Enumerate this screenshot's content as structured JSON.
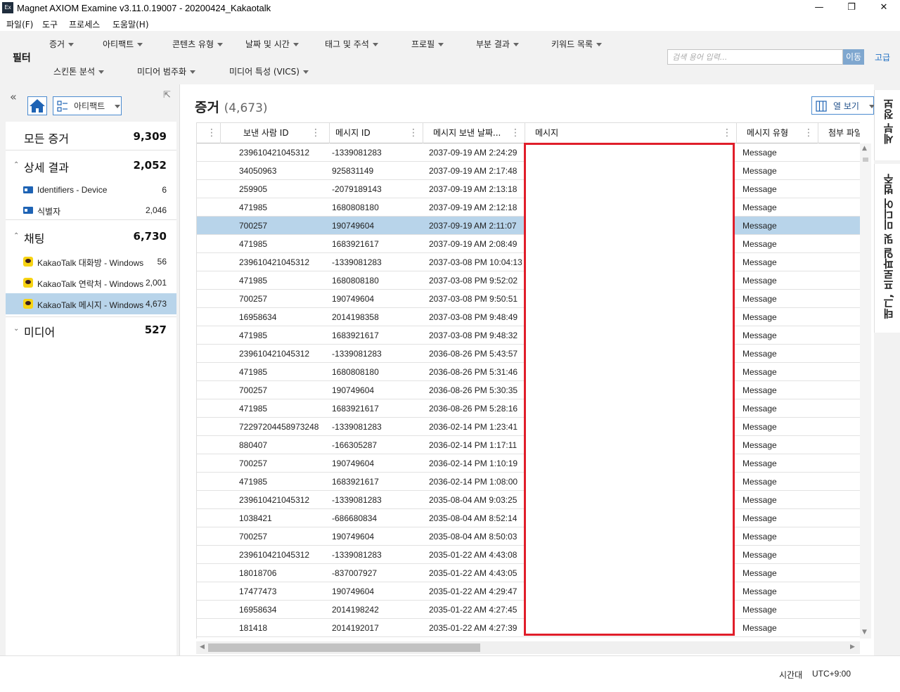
{
  "window": {
    "icon_text": "Ex",
    "title": "Magnet AXIOM Examine v3.11.0.19007 - 20200424_Kakaotalk",
    "minimize": "—",
    "restore": "❐",
    "close": "✕"
  },
  "menu": [
    "파일(F)",
    "도구",
    "프로세스",
    "도움말(H)"
  ],
  "filter": {
    "label": "필터",
    "row1": [
      "증거",
      "아티팩트",
      "콘텐츠 유형",
      "날짜 및 시간",
      "태그 및 주석",
      "프로필",
      "부분 결과",
      "키워드 목록"
    ],
    "row2": [
      "스킨톤 분석",
      "미디어 범주화",
      "미디어 특성 (VICS)"
    ],
    "search_placeholder": "검색 용어 입력...",
    "go_label": "이동",
    "advanced_label": "고급"
  },
  "left": {
    "collapse_glyph": "«",
    "pin_glyph": "⇱",
    "artifact_dropdown": "아티팩트",
    "all_evidence": {
      "label": "모든 증거",
      "count": "9,309"
    },
    "categories": [
      {
        "label": "상세 결과",
        "count": "2,052",
        "expanded": true,
        "items": [
          {
            "label": "Identifiers - Device",
            "count": "6",
            "icon": "id-card-icon"
          },
          {
            "label": "식별자",
            "count": "2,046",
            "icon": "id-card-icon"
          }
        ]
      },
      {
        "label": "채팅",
        "count": "6,730",
        "expanded": true,
        "items": [
          {
            "label": "KakaoTalk 대화방 - Windows",
            "count": "56",
            "icon": "kakaotalk-icon"
          },
          {
            "label": "KakaoTalk 연락처 - Windows",
            "count": "2,001",
            "icon": "kakaotalk-icon"
          },
          {
            "label": "KakaoTalk 메시지 - Windows",
            "count": "4,673",
            "icon": "kakaotalk-icon",
            "selected": true
          }
        ]
      },
      {
        "label": "미디어",
        "count": "527",
        "expanded": false,
        "items": []
      }
    ]
  },
  "main": {
    "title": "증거",
    "count": "(4,673)",
    "view_button": "열 보기",
    "columns": [
      "보낸 사람 ID",
      "메시지 ID",
      "메시지 보낸 날짜...",
      "메시지",
      "메시지 유형",
      "첨부 파일"
    ],
    "rows": [
      [
        "239610421045312",
        "-1339081283",
        "2037-09-19 AM 2:24:29",
        "",
        "Message"
      ],
      [
        "34050963",
        "925831149",
        "2037-09-19 AM 2:17:48",
        "",
        "Message"
      ],
      [
        "259905",
        "-2079189143",
        "2037-09-19 AM 2:13:18",
        "",
        "Message"
      ],
      [
        "471985",
        "1680808180",
        "2037-09-19 AM 2:12:18",
        "",
        "Message"
      ],
      [
        "700257",
        "190749604",
        "2037-09-19 AM 2:11:07",
        "",
        "Message"
      ],
      [
        "471985",
        "1683921617",
        "2037-09-19 AM 2:08:49",
        "",
        "Message"
      ],
      [
        "239610421045312",
        "-1339081283",
        "2037-03-08 PM 10:04:13",
        "",
        "Message"
      ],
      [
        "471985",
        "1680808180",
        "2037-03-08 PM 9:52:02",
        "",
        "Message"
      ],
      [
        "700257",
        "190749604",
        "2037-03-08 PM 9:50:51",
        "",
        "Message"
      ],
      [
        "16958634",
        "2014198358",
        "2037-03-08 PM 9:48:49",
        "",
        "Message"
      ],
      [
        "471985",
        "1683921617",
        "2037-03-08 PM 9:48:32",
        "",
        "Message"
      ],
      [
        "239610421045312",
        "-1339081283",
        "2036-08-26 PM 5:43:57",
        "",
        "Message"
      ],
      [
        "471985",
        "1680808180",
        "2036-08-26 PM 5:31:46",
        "",
        "Message"
      ],
      [
        "700257",
        "190749604",
        "2036-08-26 PM 5:30:35",
        "",
        "Message"
      ],
      [
        "471985",
        "1683921617",
        "2036-08-26 PM 5:28:16",
        "",
        "Message"
      ],
      [
        "72297204458973248",
        "-1339081283",
        "2036-02-14 PM 1:23:41",
        "",
        "Message"
      ],
      [
        "880407",
        "-166305287",
        "2036-02-14 PM 1:17:11",
        "",
        "Message"
      ],
      [
        "700257",
        "190749604",
        "2036-02-14 PM 1:10:19",
        "",
        "Message"
      ],
      [
        "471985",
        "1683921617",
        "2036-02-14 PM 1:08:00",
        "",
        "Message"
      ],
      [
        "239610421045312",
        "-1339081283",
        "2035-08-04 AM 9:03:25",
        "",
        "Message"
      ],
      [
        "1038421",
        "-686680834",
        "2035-08-04 AM 8:52:14",
        "",
        "Message"
      ],
      [
        "700257",
        "190749604",
        "2035-08-04 AM 8:50:03",
        "",
        "Message"
      ],
      [
        "239610421045312",
        "-1339081283",
        "2035-01-22 AM 4:43:08",
        "",
        "Message"
      ],
      [
        "18018706",
        "-837007927",
        "2035-01-22 AM 4:43:05",
        "",
        "Message"
      ],
      [
        "17477473",
        "190749604",
        "2035-01-22 AM 4:29:47",
        "",
        "Message"
      ],
      [
        "16958634",
        "2014198242",
        "2035-01-22 AM 4:27:45",
        "",
        "Message"
      ],
      [
        "181418",
        "2014192017",
        "2035-01-22 AM 4:27:39",
        "",
        "Message"
      ]
    ],
    "selected_row": 4,
    "highlight_color": "#e01e2a",
    "selection_color": "#b8d4ea"
  },
  "right_dock": {
    "tab1": "세부 정보",
    "tab2": "태그, 프로파일 및 미디어 범주"
  },
  "status": {
    "timezone_label": "시간대",
    "timezone_value": "UTC+9:00"
  }
}
